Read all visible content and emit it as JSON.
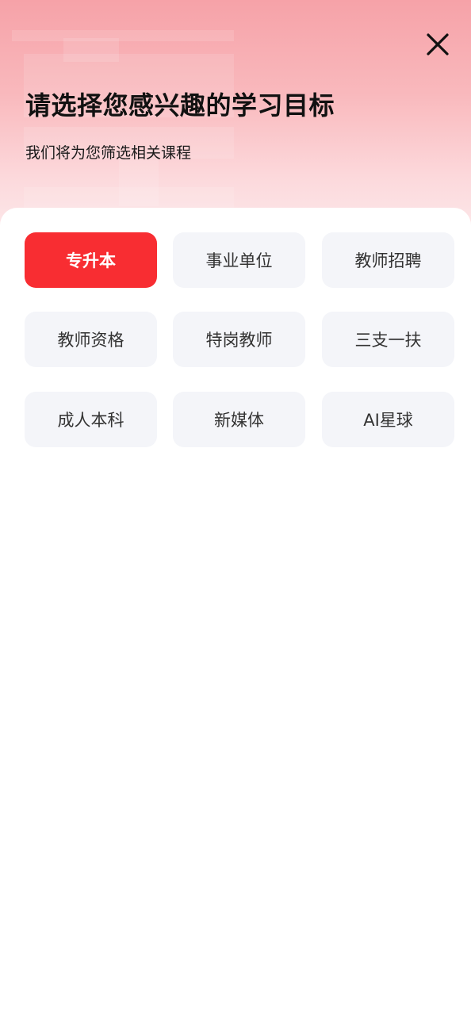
{
  "header": {
    "title": "请选择您感兴趣的学习目标",
    "subtitle": "我们将为您筛选相关课程",
    "close_icon": "close-icon",
    "background_gradient": [
      "#f6a2a8",
      "#fde9eb"
    ]
  },
  "options": [
    {
      "label": "专升本",
      "selected": true
    },
    {
      "label": "事业单位",
      "selected": false
    },
    {
      "label": "教师招聘",
      "selected": false
    },
    {
      "label": "教师资格",
      "selected": false
    },
    {
      "label": "特岗教师",
      "selected": false
    },
    {
      "label": "三支一扶",
      "selected": false
    },
    {
      "label": "成人本科",
      "selected": false
    },
    {
      "label": "新媒体",
      "selected": false
    },
    {
      "label": "AI星球",
      "selected": false
    }
  ],
  "colors": {
    "accent": "#f82d32",
    "option_bg": "#f4f5f9",
    "option_text": "#333333"
  }
}
